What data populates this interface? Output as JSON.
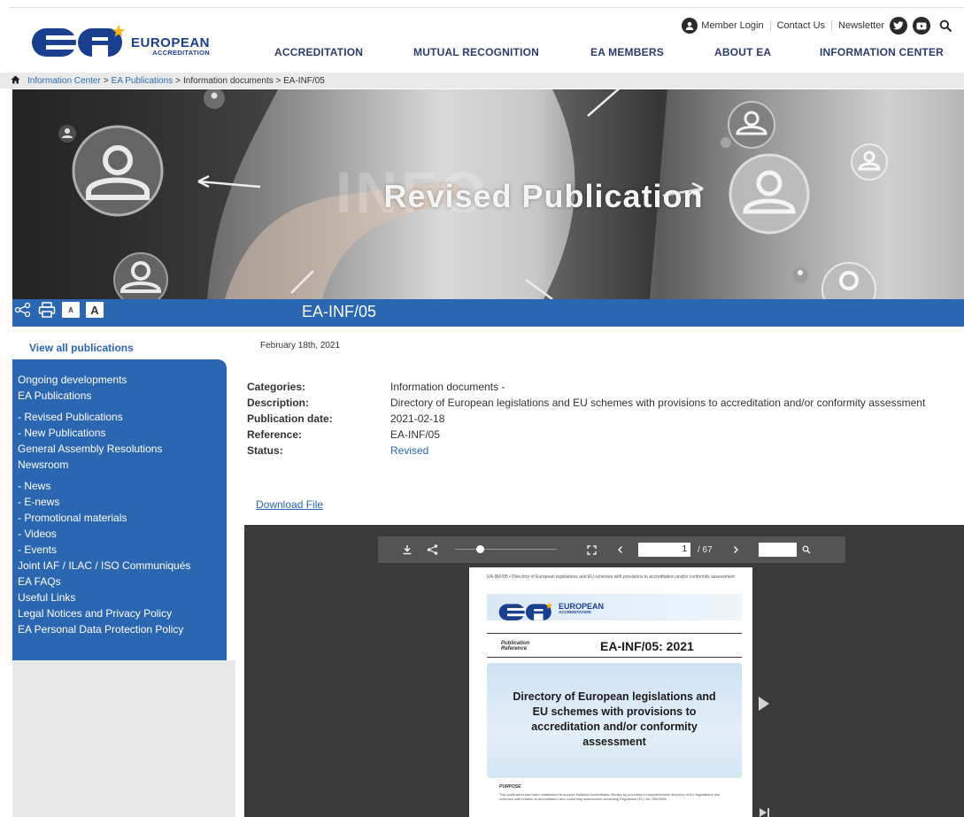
{
  "utility": {
    "member_login": "Member Login",
    "contact_us": "Contact Us",
    "newsletter": "Newsletter"
  },
  "logo": {
    "line1": "EUROPEAN",
    "line2": "ACCREDITATION"
  },
  "nav": {
    "items": [
      {
        "label": "ACCREDITATION"
      },
      {
        "label": "MUTUAL RECOGNITION"
      },
      {
        "label": "EA MEMBERS"
      },
      {
        "label": "ABOUT EA"
      },
      {
        "label": "INFORMATION CENTER"
      }
    ]
  },
  "breadcrumb": {
    "items": [
      "Information Center",
      "EA Publications"
    ],
    "current": "Information documents > EA-INF/05",
    "separator": ">"
  },
  "hero": {
    "title": "Revised Publication",
    "watermark": "INFO"
  },
  "toolbar": {
    "font_small": "A",
    "font_large": "A"
  },
  "page": {
    "title": "EA-INF/05",
    "date": "February 18th, 2021"
  },
  "sidebar": {
    "view_all": "View all publications",
    "items": [
      {
        "label": "Ongoing developments"
      },
      {
        "label": "EA Publications"
      },
      {
        "label": "-  Revised Publications"
      },
      {
        "label": "-  New Publications"
      },
      {
        "label": "General Assembly Resolutions"
      },
      {
        "label": "Newsroom"
      },
      {
        "label": "-  News"
      },
      {
        "label": "-  E-news"
      },
      {
        "label": "-  Promotional materials"
      },
      {
        "label": "-  Videos"
      },
      {
        "label": "-  Events"
      },
      {
        "label": "Joint IAF / ILAC / ISO Communiqués"
      },
      {
        "label": "EA FAQs"
      },
      {
        "label": "Useful Links"
      },
      {
        "label": "Legal Notices and Privacy Policy"
      },
      {
        "label": "EA Personal Data Protection Policy"
      }
    ]
  },
  "meta": {
    "categories_label": "Categories:",
    "categories_value": "Information documents -",
    "description_label": "Description:",
    "description_value": "Directory of European legislations and EU schemes with provisions to accreditation and/or conformity assessment",
    "pubdate_label": "Publication date:",
    "pubdate_value": "2021-02-18",
    "reference_label": "Reference:",
    "reference_value": "EA-INF/05",
    "status_label": "Status:",
    "status_value": "Revised"
  },
  "download": {
    "label": "Download File"
  },
  "viewer": {
    "current_page": "1",
    "total_pages": "/ 67",
    "pdf": {
      "header_text": "EA-INF/05 • Directory of European legislations and EU schemes with provisions to accreditation and/or conformity assessment",
      "logo_line1": "EUROPEAN",
      "logo_line2": "ACCREDITATION",
      "ref_label": "Publication Reference",
      "ref_value": "EA-INF/05: 2021",
      "box_title": "Directory of European legislations and EU schemes with provisions to accreditation and/or conformity assessment",
      "purpose_label": "PURPOSE",
      "purpose_text": "This publication has been established to support National Accreditation Bodies by providing a comprehensive directory of EU legislations and schemes with relation to accreditation and conformity assessment according Regulation (EC) No 765/2008."
    }
  },
  "colors": {
    "brand_blue": "#2b66b1",
    "logo_blue": "#1b3f8f",
    "logo_gold": "#f2b51c",
    "viewer_bg": "#3a3a3a"
  }
}
